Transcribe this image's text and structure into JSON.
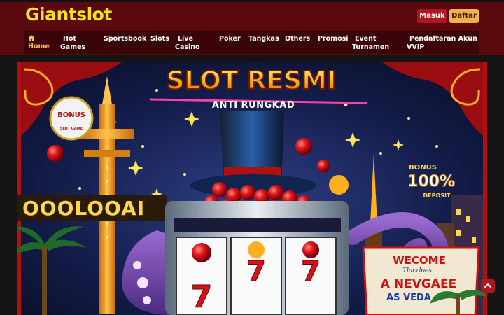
{
  "header": {
    "logo": "Giantslot",
    "login_label": "Masuk",
    "register_label": "Daftar"
  },
  "nav": {
    "items": [
      {
        "line1": "Home",
        "line2": "",
        "icon": "home-icon",
        "active": true
      },
      {
        "line1": "Hot",
        "line2": "Games"
      },
      {
        "line1": "Sportsbook",
        "line2": ""
      },
      {
        "line1": "Slots",
        "line2": ""
      },
      {
        "line1": "Live",
        "line2": "Casino"
      },
      {
        "line1": "Poker",
        "line2": ""
      },
      {
        "line1": "Tangkas",
        "line2": ""
      },
      {
        "line1": "Others",
        "line2": ""
      },
      {
        "line1": "Promosi",
        "line2": ""
      },
      {
        "line1": "Event",
        "line2": "Turnamen"
      },
      {
        "line1": "Pendaftaran Akun",
        "line2": "VVIP"
      }
    ]
  },
  "banner": {
    "title": "SLOT RESMI",
    "subtitle": "ANTI RUNGKAD",
    "bonus_badge_top": "BONUS",
    "bonus_badge_bottom": "SLOT GAME",
    "bonus_deposit_top": "BONUS",
    "bonus_deposit_pct": "100%",
    "bonus_deposit_bottom": "DEPOSIT",
    "sign_welcome": "WECOME",
    "sign_line2": "Tlacrloes",
    "sign_line3": "A NEVGAEE",
    "sign_line4": "AS VEDA",
    "reel_symbols": [
      "7",
      "7",
      "7"
    ],
    "marquee": "OOOLOOAI"
  },
  "scroll_top_icon": "chevron-up-icon",
  "colors": {
    "header_bg": "#5a0a0f",
    "nav_bg": "#3a0509",
    "logo": "#f3e21c",
    "login_btn": "#b01622",
    "register_btn": "#f2b24a",
    "active_nav": "#f3b94a"
  }
}
